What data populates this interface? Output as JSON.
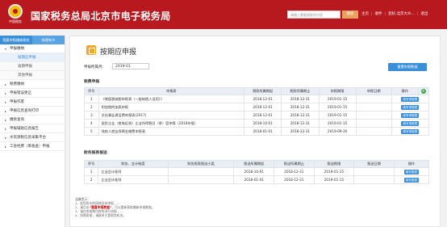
{
  "header": {
    "logo_text": "中国税务",
    "site_title": "国家税务总局北京市电子税务局",
    "search_placeholder": "请输入需要搜索的内容",
    "search_button": "搜索",
    "links": [
      "主页",
      "收件",
      "个人中心",
      "退出"
    ],
    "user_text": "您好,北京大众..."
  },
  "sidebar": {
    "tabs": [
      "我要申报缴纳税金",
      "有理有节"
    ],
    "items": [
      {
        "label": "申报缴纳",
        "expandable": true
      },
      {
        "label": "按期应申报",
        "sub": true,
        "active": true
      },
      {
        "label": "逾期申报",
        "sub": true
      },
      {
        "label": "其他申报",
        "sub": true
      },
      {
        "label": "税费缴纳",
        "expandable": true
      },
      {
        "label": "申报错误更正",
        "expandable": true
      },
      {
        "label": "申报作废",
        "expandable": true
      },
      {
        "label": "申报信息查询打印",
        "expandable": true
      },
      {
        "label": "缴款查询",
        "expandable": true
      },
      {
        "label": "申报辅助信息报告",
        "expandable": true
      },
      {
        "label": "水资源税信息采集平台",
        "expandable": true
      },
      {
        "label": "工会经费（筹备金）申报",
        "expandable": true
      }
    ]
  },
  "main": {
    "title": "按期应申报",
    "period_label": "申报所属月：",
    "period_value": "2019-01",
    "reset_button": "重置申报数据",
    "tax_section_title": "税费申报",
    "tax_table": {
      "headers": [
        "序号",
        "申报表",
        "税款所属期起",
        "税款所属期止",
        "申报期限",
        "申报日期",
        "操作"
      ],
      "rows": [
        [
          "1",
          "《增值税纳税申报表（一般纳税人适用）》",
          "2018-12-01",
          "2018-12-31",
          "2019-01-15",
          "",
          "填写申报表"
        ],
        [
          "2",
          "附加税附加表申报",
          "2018-12-01",
          "2018-12-31",
          "2019-01-15",
          "",
          "填写申报表"
        ],
        [
          "3",
          "文化事业建设费申报表(2017)",
          "2018-12-01",
          "2018-12-31",
          "2019-01-15",
          "",
          "填写申报表"
        ],
        [
          "4",
          "居民企业（查账征收）企业所得税月（季）度申报（2018年版）",
          "2018-10-01",
          "2018-12-31",
          "2019-01-15",
          "",
          "填写申报表"
        ],
        [
          "5",
          "残疾人就业保障金缴费申报表",
          "2018-01-01",
          "2018-12-31",
          "2019-09-30",
          "",
          "填写申报表"
        ]
      ]
    },
    "finance_section_title": "财务报表报送",
    "finance_table": {
      "headers": [
        "序号",
        "财务、会计制度",
        "财务报表报送小类",
        "报送所属期起",
        "报送所属期止",
        "报送期限",
        "报送日期",
        "操作"
      ],
      "rows": [
        [
          "1",
          "企业会计准则",
          "",
          "2018-10-01",
          "2018-12-31",
          "2019-01-15",
          "",
          "填写报表"
        ],
        [
          "2",
          "企业会计准则",
          "",
          "2018-01-01",
          "2018-12-31",
          "2019-01-15",
          "",
          "填写报表"
        ]
      ]
    },
    "notes": {
      "title": "温馨提示：",
      "line1": "1、若您所在的网格设有申报……",
      "line2_pre": "2、请点击",
      "line2_highlight": "“重置申报数据”",
      "line2_post": "，可以重新获取最新申报数据。",
      "line3": "3、请在申报期内按时进行申报……",
      "line4": "4、如需帮助，请联系主管税务机关。"
    }
  }
}
